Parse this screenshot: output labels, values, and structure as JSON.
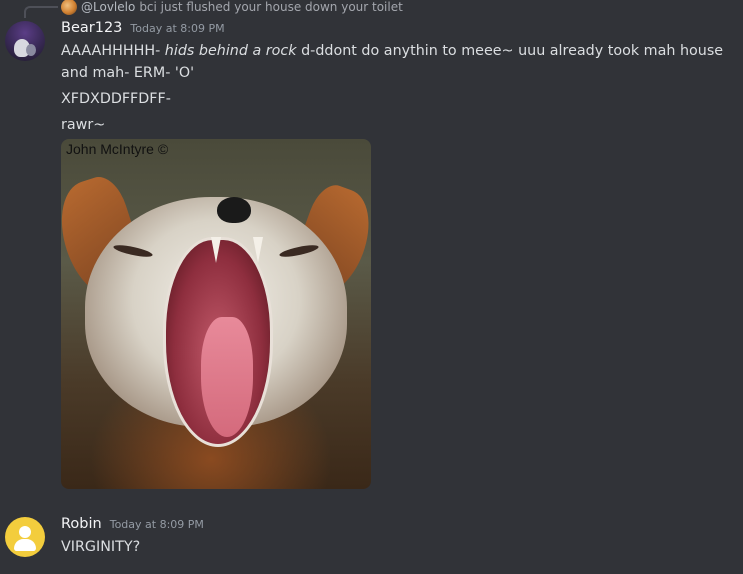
{
  "reply": {
    "author": "@Lovlelo",
    "text": "bci just flushed your house down your toilet"
  },
  "messages": [
    {
      "username": "Bear123",
      "timestamp": "Today at 8:09 PM",
      "line1_a": "AAAAHHHHH-",
      "line1_em": "hids behind a rock",
      "line1_b": "d-ddont do anythin to meee~ uuu already took mah house and mah- ERM- 'O'",
      "line2": "XFDXDDFFDFF-",
      "line3": "rawr~",
      "attachment": {
        "watermark": "John McIntyre ©"
      }
    },
    {
      "username": "Robin",
      "timestamp": "Today at 8:09 PM",
      "text": "VIRGINITY?"
    }
  ],
  "colors": {
    "background": "#313338",
    "username": "#f2f3f5",
    "timestamp": "#949ba4",
    "text": "#dbdee1",
    "robin_avatar": "#f3cd3d"
  }
}
